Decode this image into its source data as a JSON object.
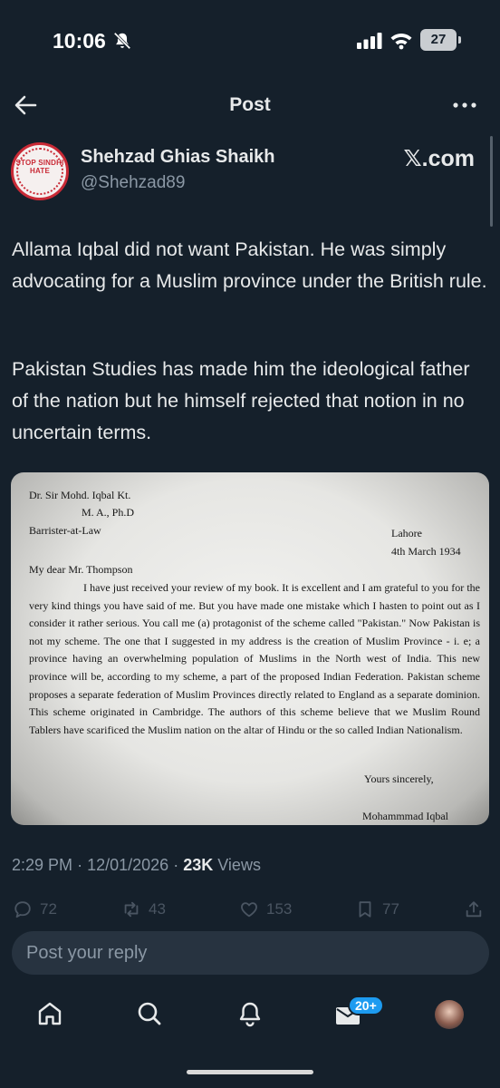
{
  "status_bar": {
    "time": "10:06",
    "battery": "27"
  },
  "header": {
    "title": "Post"
  },
  "author": {
    "name": "Shehzad Ghias Shaikh",
    "handle": "@Shehzad89",
    "avatar_text": "STOP SINDHI HATE",
    "source_label": "𝕏.com"
  },
  "post": {
    "paragraphs": [
      "Allama Iqbal did not want Pakistan. He was simply advocating for a Muslim province under the British rule.",
      "Pakistan Studies has made him the ideological father of the nation but he himself rejected that notion in no uncertain terms."
    ]
  },
  "letter": {
    "line1": "Dr. Sir Mohd. Iqbal Kt.",
    "line2": "M. A., Ph.D",
    "line3": "Barrister-at-Law",
    "place": "Lahore",
    "date": "4th March 1934",
    "salutation": "My dear Mr. Thompson",
    "body": "I have just received your review of my book. It is excellent and I am grateful to you for the very kind things you have said of me. But you have made one mistake which I hasten to point out as I consider it rather serious. You call me (a) protagonist of the scheme called \"Pakistan.\" Now Pakistan is not my scheme. The one that I suggested in my address is the creation of Muslim Province - i. e; a province having an overwhelming population of Muslims in the North west of India. This new province will be, according to my scheme, a part of the proposed Indian Federation. Pakistan scheme proposes a separate federation of Muslim Provinces directly related to England as a separate dominion. This scheme originated in Cambridge. The authors of this scheme believe that we Muslim Round Tablers have scarificed the Muslim nation on the altar of Hindu or the so called Indian Nationalism.",
    "closing": "Yours sincerely,",
    "signature": "Mohammmad Iqbal"
  },
  "meta": {
    "time": "2:29 PM",
    "sep1": "·",
    "date": "12/01/2026",
    "sep2": "·",
    "views_count": "23K",
    "views_label": "Views"
  },
  "actions": {
    "replies": "72",
    "reposts": "43",
    "likes": "153",
    "bookmarks": "77"
  },
  "reply": {
    "placeholder": "Post your reply"
  },
  "tabbar": {
    "messages_badge": "20+"
  },
  "colors": {
    "background": "#15202b",
    "accent": "#1d9bf0",
    "muted": "#8b98a5",
    "input_bg": "#273340"
  }
}
